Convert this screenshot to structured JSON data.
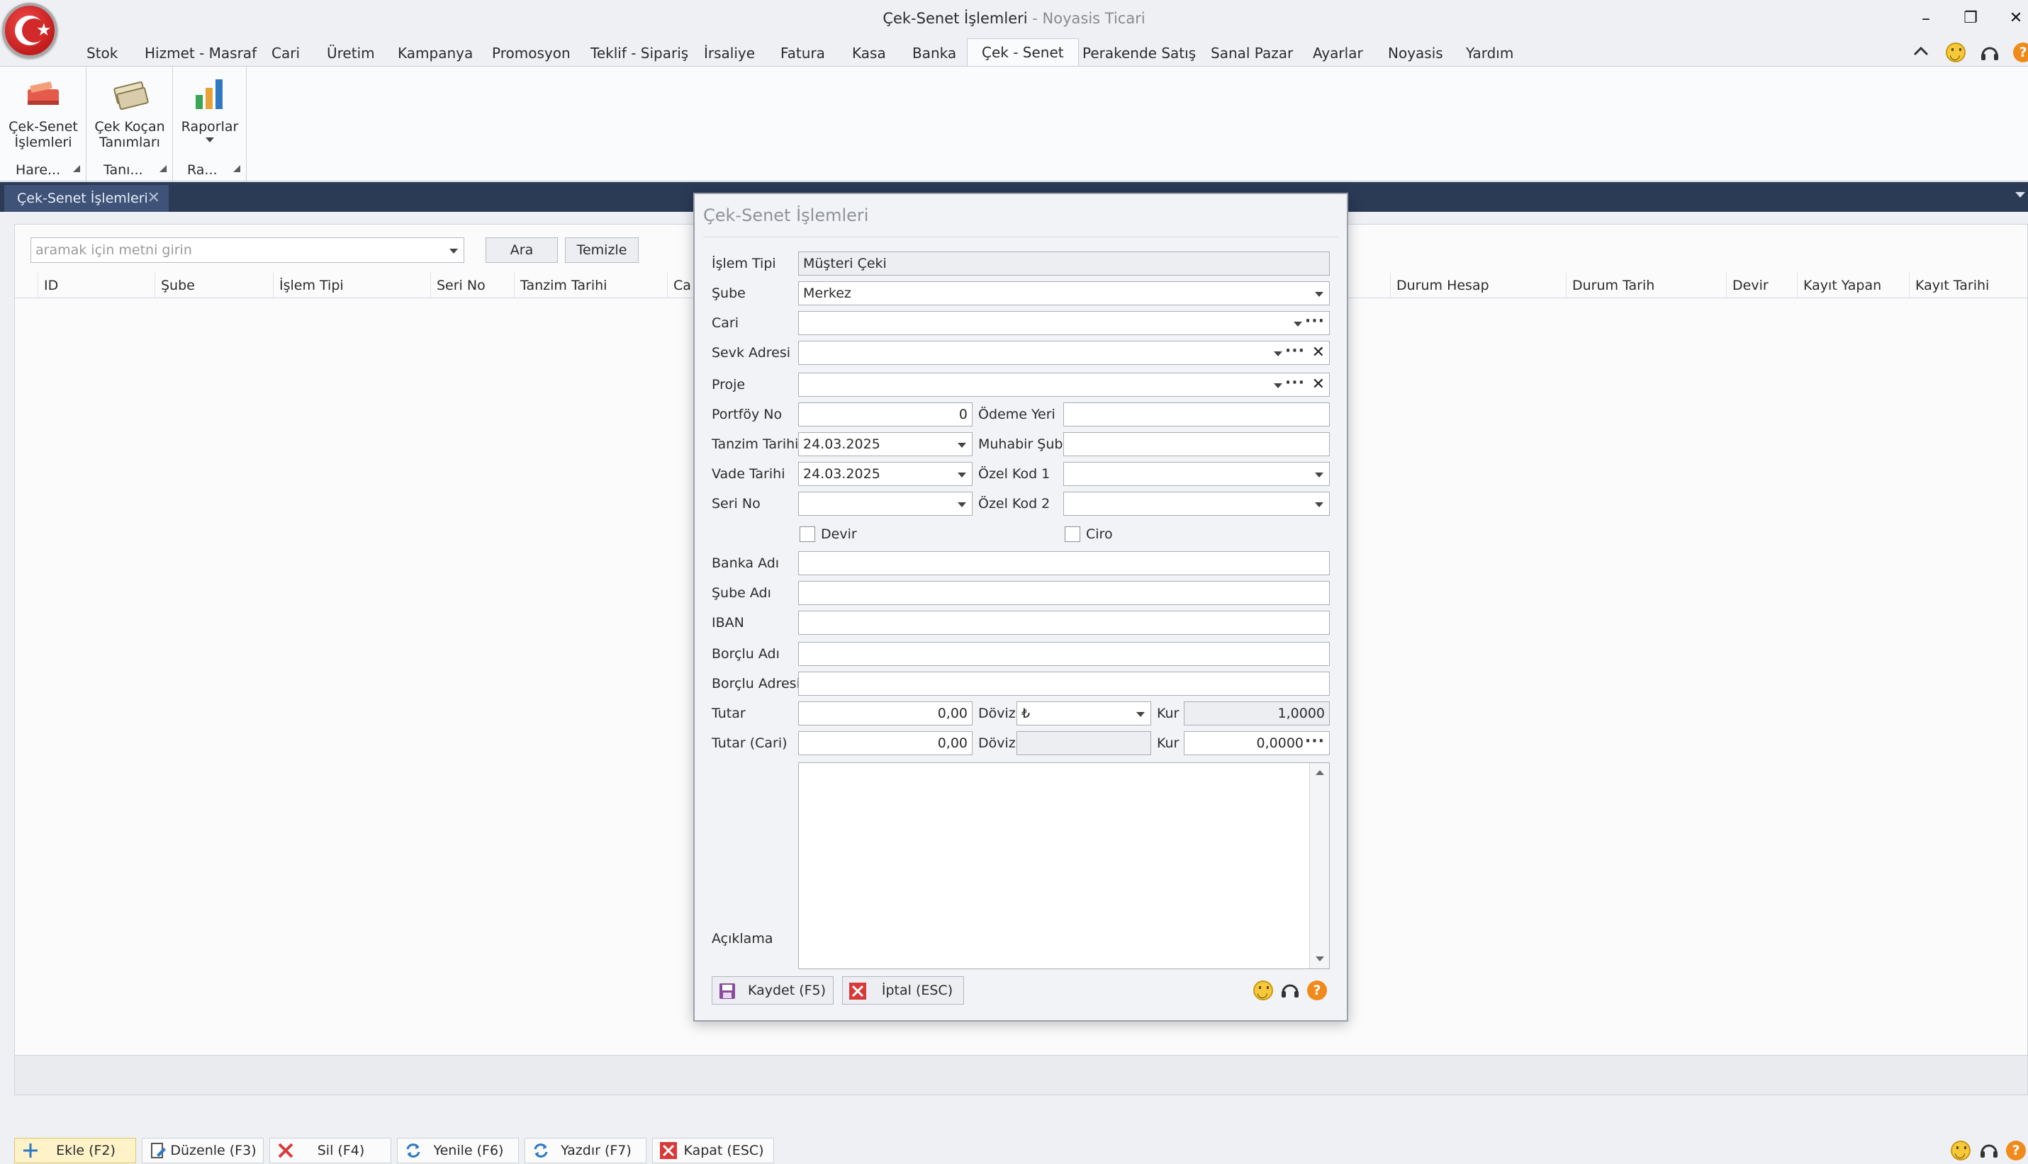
{
  "window": {
    "title": "Çek-Senet İşlemleri",
    "separator": " - ",
    "app_name": "Noyasis Ticari",
    "minimize": "–",
    "restore": "❐",
    "close": "✕"
  },
  "menu": {
    "tabs": [
      {
        "label": "Stok"
      },
      {
        "label": "Hizmet - Masraf"
      },
      {
        "label": "Cari"
      },
      {
        "label": "Üretim"
      },
      {
        "label": "Kampanya"
      },
      {
        "label": "Promosyon"
      },
      {
        "label": "Teklif - Sipariş"
      },
      {
        "label": "İrsaliye"
      },
      {
        "label": "Fatura"
      },
      {
        "label": "Kasa"
      },
      {
        "label": "Banka"
      },
      {
        "label": "Çek - Senet"
      },
      {
        "label": "Perakende Satış"
      },
      {
        "label": "Sanal Pazar"
      },
      {
        "label": "Ayarlar"
      },
      {
        "label": "Noyasis"
      },
      {
        "label": "Yardım"
      }
    ],
    "active": "Çek - Senet"
  },
  "ribbon": {
    "groups": [
      {
        "label": "Hare...",
        "button_line1": "Çek-Senet",
        "button_line2": "İşlemleri"
      },
      {
        "label": "Tanı...",
        "button_line1": "Çek Koçan",
        "button_line2": "Tanımları"
      },
      {
        "label": "Ra...",
        "button_line1": "Raporlar",
        "button_line2": ""
      }
    ]
  },
  "doc_tab": {
    "label": "Çek-Senet İşlemleri",
    "close": "✕"
  },
  "search": {
    "placeholder": "aramak için metni girin",
    "search_button": "Ara",
    "clear_button": "Temizle"
  },
  "grid": {
    "columns_left": [
      "ID",
      "Şube",
      "İşlem Tipi",
      "Seri No",
      "Tanzim Tarihi",
      "Ca"
    ],
    "columns_right": [
      "Durum Hesap",
      "Durum Tarih",
      "Devir",
      "Kayıt Yapan",
      "Kayıt Tarihi"
    ]
  },
  "bottom_toolbar": {
    "buttons": [
      {
        "label": "Ekle (F2)"
      },
      {
        "label": "Düzenle (F3)"
      },
      {
        "label": "Sil (F4)"
      },
      {
        "label": "Yenile (F6)"
      },
      {
        "label": "Yazdır (F7)"
      },
      {
        "label": "Kapat (ESC)"
      }
    ]
  },
  "dialog": {
    "title": "Çek-Senet İşlemleri",
    "labels": {
      "islem_tipi": "İşlem Tipi",
      "sube": "Şube",
      "cari": "Cari",
      "sevk_adresi": "Sevk Adresi",
      "proje": "Proje",
      "portfoy_no": "Portföy No",
      "odeme_yeri": "Ödeme Yeri",
      "tanzim_tarihi": "Tanzim Tarihi",
      "muhabir_sube": "Muhabir Şube",
      "vade_tarihi": "Vade Tarihi",
      "ozel_kod_1": "Özel Kod 1",
      "seri_no": "Seri No",
      "ozel_kod_2": "Özel Kod 2",
      "devir": "Devir",
      "ciro": "Ciro",
      "banka_adi": "Banka Adı",
      "sube_adi": "Şube Adı",
      "iban": "IBAN",
      "borclu_adi": "Borçlu Adı",
      "borclu_adresi": "Borçlu Adresi",
      "tutar": "Tutar",
      "doviz": "Döviz",
      "kur": "Kur",
      "tutar_cari": "Tutar (Cari)",
      "doviz_2": "Döviz",
      "kur_2": "Kur",
      "aciklama": "Açıklama"
    },
    "values": {
      "islem_tipi": "Müşteri Çeki",
      "sube": "Merkez",
      "cari": "",
      "sevk_adresi": "",
      "proje": "",
      "portfoy_no": "0",
      "odeme_yeri": "",
      "tanzim_tarihi": "24.03.2025",
      "muhabir_sube": "",
      "vade_tarihi": "24.03.2025",
      "ozel_kod_1": "",
      "seri_no": "",
      "ozel_kod_2": "",
      "banka_adi": "",
      "sube_adi": "",
      "iban": "",
      "borclu_adi": "",
      "borclu_adresi": "",
      "tutar": "0,00",
      "doviz": "₺",
      "kur": "1,0000",
      "tutar_cari": "0,00",
      "doviz_2": "",
      "kur_2": "0,0000",
      "aciklama": ""
    },
    "checks": {
      "devir": false,
      "ciro": false
    },
    "buttons": {
      "save": "Kaydet (F5)",
      "cancel": "İptal (ESC)"
    }
  },
  "colors": {
    "accent_dark": "#2b3a55",
    "accent_tab": "#3f5278",
    "active_button": "#fdf2c8",
    "danger": "#d83a3a"
  }
}
